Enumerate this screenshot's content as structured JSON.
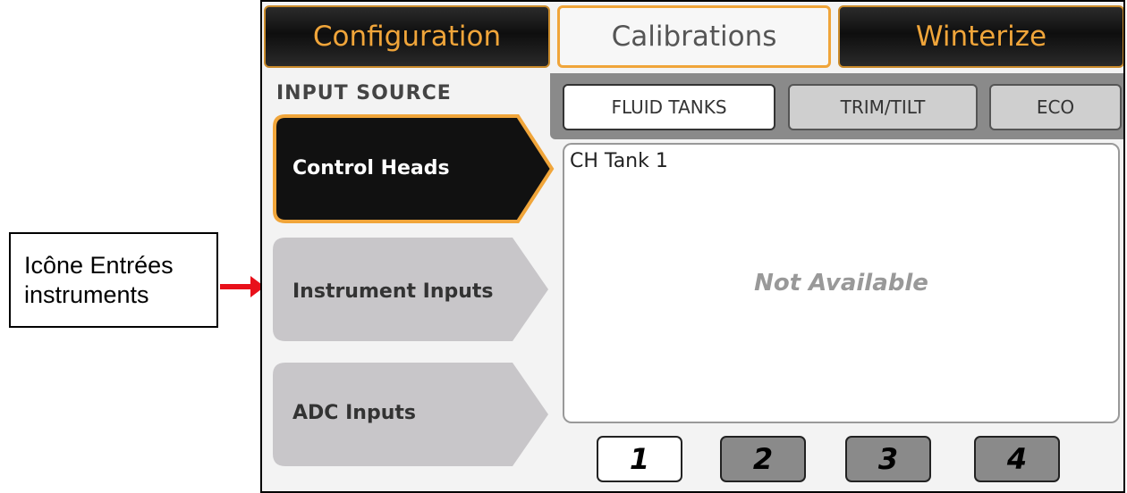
{
  "annotation": {
    "line1": "Icône Entrées",
    "line2": "instruments",
    "arrow_color": "#e8101a"
  },
  "top_tabs": [
    {
      "label": "Configuration",
      "state": "inactive"
    },
    {
      "label": "Calibrations",
      "state": "active"
    },
    {
      "label": "Winterize",
      "state": "inactive"
    }
  ],
  "input_source": {
    "title": "INPUT SOURCE",
    "items": [
      {
        "label": "Control Heads",
        "selected": true
      },
      {
        "label": "Instrument Inputs",
        "selected": false
      },
      {
        "label": "ADC Inputs",
        "selected": false
      }
    ]
  },
  "sub_tabs": [
    {
      "label": "FLUID TANKS",
      "selected": true
    },
    {
      "label": "TRIM/TILT",
      "selected": false
    },
    {
      "label": "ECO",
      "selected": false
    }
  ],
  "panel": {
    "title": "CH Tank 1",
    "status": "Not Available"
  },
  "pages": {
    "buttons": [
      "1",
      "2",
      "3",
      "4"
    ],
    "current": "1"
  },
  "colors": {
    "accent": "#f0a53a",
    "dark": "#111111",
    "inactive_gray": "#c8c6c9"
  }
}
